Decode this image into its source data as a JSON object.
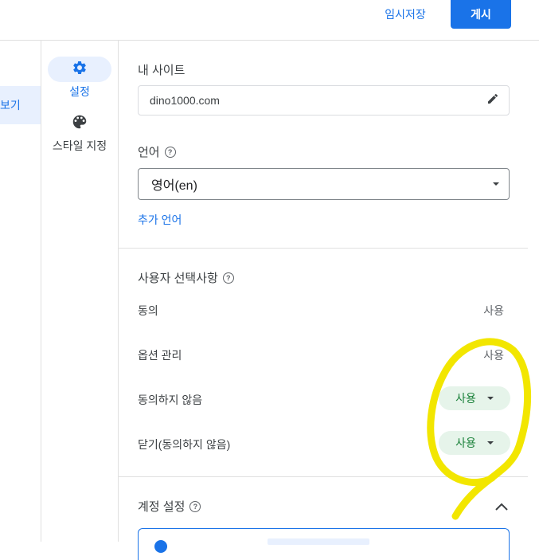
{
  "topbar": {
    "draft_label": "임시저장",
    "publish_label": "게시"
  },
  "leftnav": {
    "active_label": "보기"
  },
  "sidenav": {
    "items": [
      {
        "label": "설정",
        "icon": "gear-icon",
        "active": true
      },
      {
        "label": "스타일 지정",
        "icon": "palette-icon",
        "active": false
      }
    ]
  },
  "site": {
    "label": "내 사이트",
    "value": "dino1000.com"
  },
  "language": {
    "label": "언어",
    "value": "영어(en)",
    "add_link": "추가 언어"
  },
  "user_choices": {
    "title": "사용자 선택사항",
    "rows": [
      {
        "label": "동의",
        "value": "사용"
      },
      {
        "label": "옵션 관리",
        "value": "사용"
      },
      {
        "label": "동의하지 않음",
        "value": "사용"
      },
      {
        "label": "닫기(동의하지 않음)",
        "value": "사용"
      }
    ]
  },
  "account": {
    "title": "계정 설정"
  },
  "colors": {
    "accent": "#1a73e8",
    "chip_bg": "#e6f4ea",
    "chip_text": "#188038",
    "annotation": "#f2e600"
  }
}
